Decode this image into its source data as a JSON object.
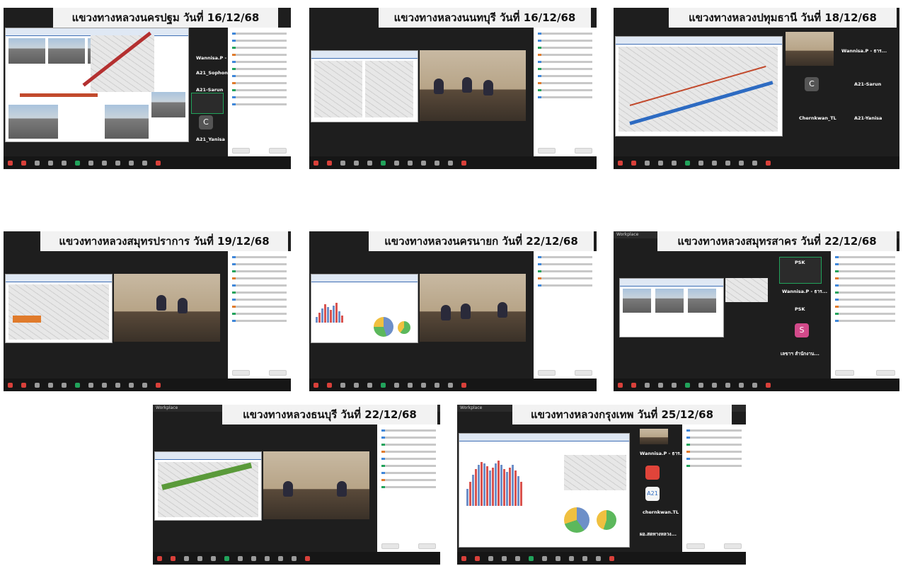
{
  "tiles": [
    {
      "banner": "แขวงทางหลวงนครปฐม วันที่ 16/12/68"
    },
    {
      "banner": "แขวงทางหลวงนนทบุรี วันที่ 16/12/68"
    },
    {
      "banner": "แขวงทางหลวงปทุมธานี วันที่ 18/12/68"
    },
    {
      "banner": "แขวงทางหลวงสมุทรปราการ วันที่ 19/12/68"
    },
    {
      "banner": "แขวงทางหลวงนครนายก วันที่ 22/12/68"
    },
    {
      "banner": "แขวงทางหลวงสมุทรสาคร วันที่ 22/12/68"
    },
    {
      "banner": "แขวงทางหลวงธนบุรี วันที่ 22/12/68"
    },
    {
      "banner": "แขวงทางหลวงกรุงเทพ วันที่ 25/12/68"
    }
  ],
  "videos": {
    "t1": [
      "Wannisa.P - ธาร...",
      "A21_Sophon",
      "A21-Sarun",
      "A21_Yanisa"
    ],
    "t3": [
      "Wannisa.P - ธาร...",
      "A21-Sarun",
      "Chernkwan_TL",
      "A21-Yanisa"
    ],
    "t6": [
      "PSK",
      "Wannisa.P - ธาร...",
      "PSK",
      "เลขาฯ สำนักงาน..."
    ],
    "t8": [
      "Wannisa.P - ธาร...",
      "chernkwan.TL",
      "ผอ.สดทางหลวง..."
    ]
  },
  "avatars": {
    "c_letter": "C",
    "s_letter": "S",
    "a21": "A21"
  },
  "app_label": "Workplace",
  "colors": {
    "banner_bg": "#f2f2f2",
    "meeting_bg": "#1e1e1e",
    "toolbar_bg": "#161616",
    "accent_red": "#d9403a",
    "share_green": "#21a35b"
  }
}
